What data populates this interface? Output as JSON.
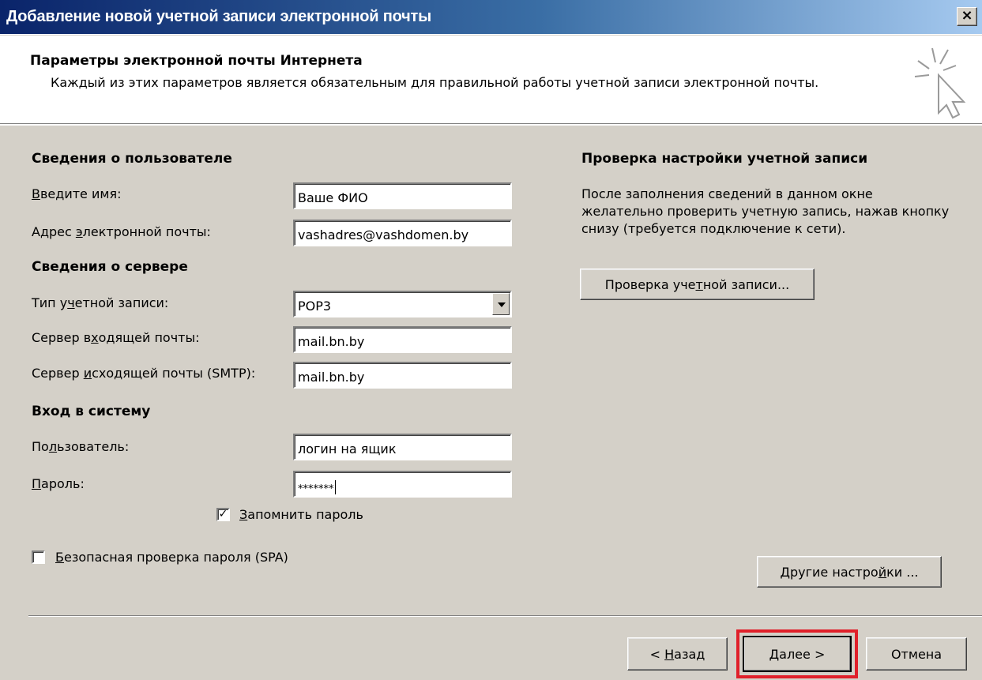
{
  "window": {
    "title": "Добавление новой учетной записи электронной почты",
    "close_glyph": "×"
  },
  "header": {
    "title": "Параметры электронной почты Интернета",
    "description": "Каждый из этих параметров является обязательным для правильной работы учетной записи электронной почты."
  },
  "user_info": {
    "section_title": "Сведения о пользователе",
    "name_label": {
      "hot": "В",
      "rest": "ведите имя:"
    },
    "name_value": "Ваше ФИО",
    "email_label": {
      "pre": "Адрес ",
      "hot": "э",
      "rest": "лектронной почты:"
    },
    "email_value": "vashadres@vashdomen.by"
  },
  "server_info": {
    "section_title": "Сведения о сервере",
    "account_type_label": {
      "pre": "Тип у",
      "hot": "ч",
      "rest": "етной записи:"
    },
    "account_type_value": "POP3",
    "incoming_label": {
      "pre": "Сервер в",
      "hot": "х",
      "rest": "одящей почты:"
    },
    "incoming_value": "mail.bn.by",
    "outgoing_label": {
      "pre": "Сервер ",
      "hot": "и",
      "rest": "сходящей почты (SMTP):"
    },
    "outgoing_value": "mail.bn.by"
  },
  "logon": {
    "section_title": "Вход в систему",
    "user_label": {
      "pre": "По",
      "hot": "л",
      "rest": "ьзователь:"
    },
    "user_value": "логин на ящик",
    "password_label": {
      "hot": "П",
      "rest": "ароль:"
    },
    "password_value": "*******",
    "remember": {
      "hot": "З",
      "rest": "апомнить пароль",
      "checked": true,
      "check_glyph": "✓"
    },
    "spa": {
      "hot": "Б",
      "rest": "езопасная проверка пароля (SPA)",
      "checked": false
    }
  },
  "test_panel": {
    "title": "Проверка настройки учетной записи",
    "description": "После заполнения сведений в данном окне желательно проверить учетную запись, нажав кнопку снизу (требуется подключение к сети).",
    "test_button": {
      "pre": "Проверка уче",
      "hot": "т",
      "rest": "ной записи..."
    },
    "more_button": {
      "pre": "Другие настро",
      "hot": "й",
      "rest": "ки ..."
    }
  },
  "footer": {
    "back_button": {
      "pre": "< ",
      "hot": "Н",
      "rest": "азад"
    },
    "next_button": {
      "hot": "Д",
      "rest": "алее >"
    },
    "cancel_button": "Отмена"
  },
  "colors": {
    "titlebar_start": "#0a246a",
    "titlebar_end": "#a6caf0",
    "dialog_bg": "#d4d0c8",
    "highlight": "#e0202a"
  }
}
